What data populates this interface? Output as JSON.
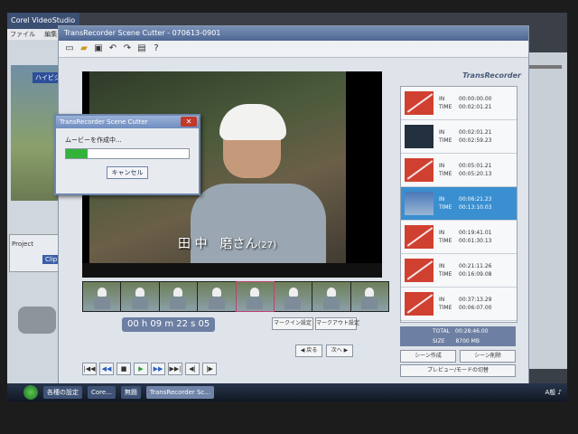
{
  "bg_app": {
    "title": "Corel VideoStudio",
    "menu": [
      "ファイル",
      "編集"
    ],
    "badge": "ハイビジ",
    "project_label": "Project",
    "clip_label": "Clip"
  },
  "main": {
    "title": "TransRecorder Scene Cutter - 070613-0901",
    "subtitle": "田 中　磨さん",
    "subtitle_age": "(27)",
    "timecode": "00 h 09 m 22 s 05",
    "buttons": {
      "mark_in": "マークイン設定",
      "mark_out": "マークアウト設定",
      "prev": "◀ 戻る",
      "next": "次へ ▶",
      "scene_add": "シーン作成",
      "scene_del": "シーン削除",
      "preview": "プレビュー/モードの切替"
    },
    "logo": "TransRecorder",
    "scenes": [
      {
        "in": "00:00:00.00",
        "time": "00:02:01.21",
        "thumb": "red"
      },
      {
        "in": "00:02:01.21",
        "time": "00:02:59.23",
        "thumb": "dark"
      },
      {
        "in": "00:05:01.21",
        "time": "00:05:20.13",
        "thumb": "red"
      },
      {
        "in": "00:06:21.23",
        "time": "00:13:10.03",
        "thumb": "sky",
        "selected": true
      },
      {
        "in": "00:19:41.01",
        "time": "00:01:30.13",
        "thumb": "red"
      },
      {
        "in": "00:21:11.26",
        "time": "00:16:09.08",
        "thumb": "red"
      },
      {
        "in": "00:37:13.29",
        "time": "00:06:07.00",
        "thumb": "red"
      }
    ],
    "labels": {
      "in": "IN",
      "time": "TIME"
    },
    "total": "TOTAL　00:28:46.00",
    "size": "SIZE　　8700 MB"
  },
  "dialog": {
    "title": "TransRecorder Scene Cutter",
    "message": "ムービーを作成中...",
    "progress": 0.18,
    "cancel": "キャンセル",
    "close": "✕"
  },
  "taskbar": {
    "items": [
      "各種の設定",
      "Core...",
      "無題",
      "TransRecorder Sc..."
    ],
    "tray": "A般 ♪"
  }
}
